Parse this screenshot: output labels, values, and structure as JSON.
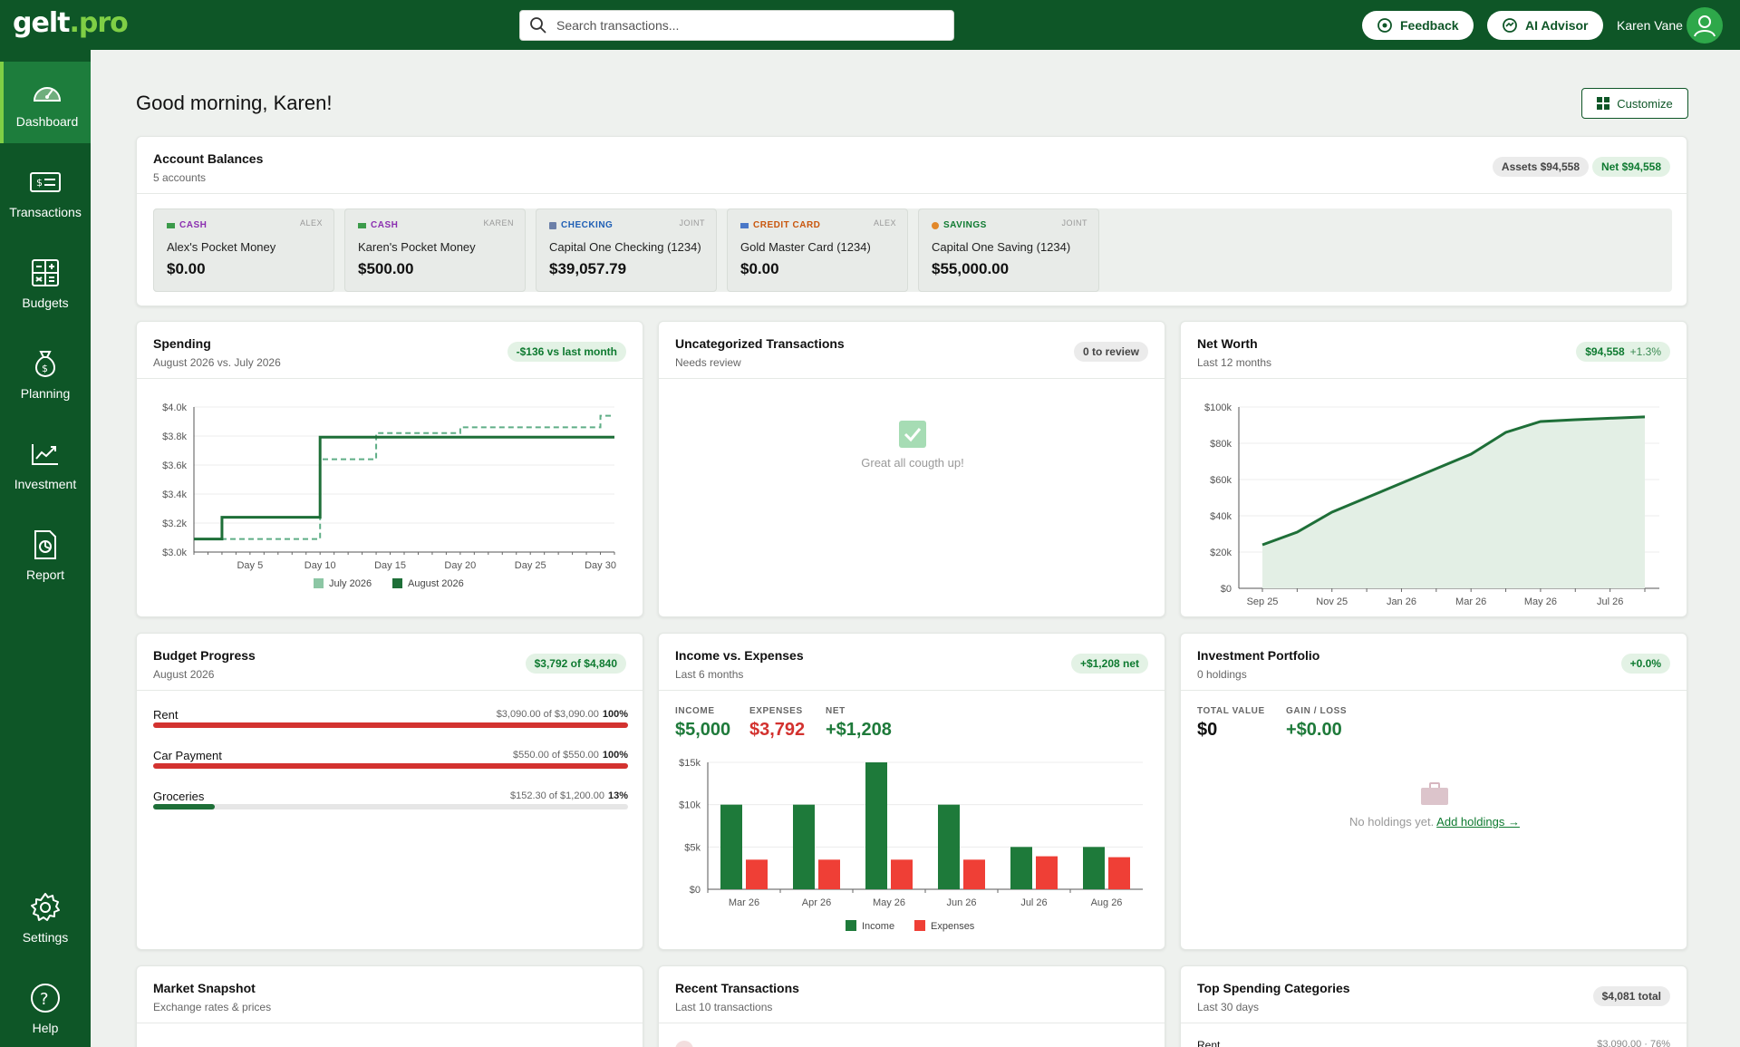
{
  "brand": {
    "logo_main": "gelt",
    "logo_dot": ".",
    "logo_suffix": "pro"
  },
  "search": {
    "placeholder": "Search transactions..."
  },
  "header": {
    "feedback_label": "Feedback",
    "ai_label": "AI Advisor",
    "user_name": "Karen Vane"
  },
  "sidebar": {
    "items": [
      {
        "label": "Dashboard",
        "icon": "gauge-icon"
      },
      {
        "label": "Transactions",
        "icon": "money-icon"
      },
      {
        "label": "Budgets",
        "icon": "calculator-icon"
      },
      {
        "label": "Planning",
        "icon": "money-bag-icon"
      },
      {
        "label": "Investment",
        "icon": "trend-chart-icon"
      },
      {
        "label": "Report",
        "icon": "report-icon"
      },
      {
        "label": "Settings",
        "icon": "gear-icon"
      },
      {
        "label": "Help",
        "icon": "help-icon"
      }
    ]
  },
  "page": {
    "greeting": "Good morning, Karen!",
    "customize_label": "Customize"
  },
  "balances": {
    "title": "Account Balances",
    "subtitle": "5 accounts",
    "assets_badge": "Assets $94,558",
    "net_badge": "Net $94,558",
    "accounts": [
      {
        "type": "CASH",
        "owner": "ALEX",
        "name": "Alex's Pocket Money",
        "balance": "$0.00",
        "color": "#8b2fb0"
      },
      {
        "type": "CASH",
        "owner": "KAREN",
        "name": "Karen's Pocket Money",
        "balance": "$500.00",
        "color": "#8b2fb0"
      },
      {
        "type": "CHECKING",
        "owner": "JOINT",
        "name": "Capital One Checking (1234)",
        "balance": "$39,057.79",
        "color": "#1f5fb5"
      },
      {
        "type": "CREDIT CARD",
        "owner": "ALEX",
        "name": "Gold Master Card (1234)",
        "balance": "$0.00",
        "color": "#c9560d"
      },
      {
        "type": "SAVINGS",
        "owner": "JOINT",
        "name": "Capital One Saving (1234)",
        "balance": "$55,000.00",
        "color": "#0e7a30"
      }
    ]
  },
  "spending": {
    "title": "Spending",
    "subtitle": "August 2026 vs. July 2026",
    "badge": "-$136 vs last month"
  },
  "uncategorized": {
    "title": "Uncategorized Transactions",
    "subtitle": "Needs review",
    "badge": "0 to review",
    "empty": "Great all cougth up!"
  },
  "networth": {
    "title": "Net Worth",
    "subtitle": "Last 12 months",
    "badge_value": "$94,558",
    "badge_change": "+1.3%"
  },
  "budget": {
    "title": "Budget Progress",
    "subtitle": "August 2026",
    "badge": "$3,792 of $4,840",
    "items": [
      {
        "label": "Rent",
        "amount": "$3,090.00 of $3,090.00",
        "pct_label": "100%",
        "pct": 1.0,
        "color": "#d3322f"
      },
      {
        "label": "Car Payment",
        "amount": "$550.00 of $550.00",
        "pct_label": "100%",
        "pct": 1.0,
        "color": "#d3322f"
      },
      {
        "label": "Groceries",
        "amount": "$152.30 of $1,200.00",
        "pct_label": "13%",
        "pct": 0.13,
        "color": "#1e6f38"
      }
    ]
  },
  "income_expenses": {
    "title": "Income vs. Expenses",
    "subtitle": "Last 6 months",
    "badge": "+$1,208 net",
    "income_label": "INCOME",
    "income_value": "$5,000",
    "expenses_label": "EXPENSES",
    "expenses_value": "$3,792",
    "net_label": "NET",
    "net_value": "+$1,208"
  },
  "portfolio": {
    "title": "Investment Portfolio",
    "subtitle": "0 holdings",
    "badge": "+0.0%",
    "total_label": "TOTAL VALUE",
    "total_value": "$0",
    "gain_label": "GAIN / LOSS",
    "gain_value": "+$0.00",
    "empty_text": "No holdings yet.",
    "add_link": "Add holdings →"
  },
  "market": {
    "title": "Market Snapshot",
    "subtitle": "Exchange rates & prices"
  },
  "recent": {
    "title": "Recent Transactions",
    "subtitle": "Last 10 transactions"
  },
  "top_spending": {
    "title": "Top Spending Categories",
    "subtitle": "Last 30 days",
    "badge": "$4,081 total",
    "first_row_label": "Rent",
    "first_row_amount": "$3,090.00 · 76%"
  },
  "colors": {
    "brand": "#0e5627",
    "accent": "#7fcf45",
    "income": "#1e7a3a",
    "expense": "#ef3f36"
  },
  "chart_data": [
    {
      "type": "line",
      "title": "Spending",
      "x": [
        1,
        2,
        3,
        4,
        5,
        6,
        7,
        8,
        9,
        10,
        11,
        12,
        13,
        14,
        15,
        16,
        17,
        18,
        19,
        20,
        21,
        22,
        23,
        24,
        25,
        26,
        27,
        28,
        29,
        30,
        31
      ],
      "xticks": [
        "Day 5",
        "Day 10",
        "Day 15",
        "Day 20",
        "Day 25",
        "Day 30"
      ],
      "xtick_values": [
        5,
        10,
        15,
        20,
        25,
        30
      ],
      "yticks": [
        "$3.0k",
        "$3.2k",
        "$3.4k",
        "$3.6k",
        "$3.8k",
        "$4.0k"
      ],
      "ylim": [
        3000,
        4000
      ],
      "series": [
        {
          "name": "July 2026",
          "style": "dashed",
          "color": "#5fae86",
          "points": [
            [
              1,
              3090
            ],
            [
              9,
              3090
            ],
            [
              10,
              3640
            ],
            [
              13,
              3640
            ],
            [
              14,
              3820
            ],
            [
              19,
              3820
            ],
            [
              20,
              3860
            ],
            [
              29,
              3860
            ],
            [
              30,
              3940
            ],
            [
              31,
              3940
            ]
          ]
        },
        {
          "name": "August 2026",
          "style": "solid",
          "color": "#1e6f38",
          "points": [
            [
              1,
              3090
            ],
            [
              2,
              3090
            ],
            [
              3,
              3240
            ],
            [
              9,
              3240
            ],
            [
              10,
              3792
            ],
            [
              31,
              3792
            ]
          ]
        }
      ],
      "legend": "bottom"
    },
    {
      "type": "area",
      "title": "Net Worth",
      "categories": [
        "Sep 25",
        "Oct 25",
        "Nov 25",
        "Dec 25",
        "Jan 26",
        "Feb 26",
        "Mar 26",
        "Apr 26",
        "May 26",
        "Jun 26",
        "Jul 26",
        "Aug 26"
      ],
      "xticks": [
        "Sep 25",
        "Nov 25",
        "Jan 26",
        "Mar 26",
        "May 26",
        "Jul 26"
      ],
      "yticks": [
        "$0",
        "$20k",
        "$40k",
        "$60k",
        "$80k",
        "$100k"
      ],
      "ylim": [
        0,
        100000
      ],
      "values": [
        24000,
        31000,
        42000,
        50000,
        58000,
        66000,
        74000,
        86000,
        92000,
        93000,
        93800,
        94558
      ]
    },
    {
      "type": "bar",
      "title": "Income vs. Expenses",
      "categories": [
        "Mar 26",
        "Apr 26",
        "May 26",
        "Jun 26",
        "Jul 26",
        "Aug 26"
      ],
      "yticks": [
        "$0",
        "$5k",
        "$10k",
        "$15k"
      ],
      "ylim": [
        0,
        15000
      ],
      "series": [
        {
          "name": "Income",
          "color": "#1e7a3a",
          "values": [
            10000,
            10000,
            15000,
            10000,
            5000,
            5000
          ]
        },
        {
          "name": "Expenses",
          "color": "#ef3f36",
          "values": [
            3500,
            3500,
            3500,
            3500,
            3900,
            3792
          ]
        }
      ],
      "legend": "bottom"
    }
  ]
}
